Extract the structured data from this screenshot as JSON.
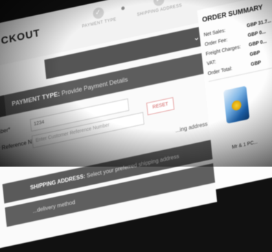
{
  "header": {
    "title": "CKOUT",
    "steps": [
      {
        "label": "PAYMENT TYPE"
      },
      {
        "label": "SHIPPING ADDRESS"
      }
    ]
  },
  "sections": {
    "payment": {
      "title": "PAYMENT TYPE:",
      "subtitle": "Provide Payment Details"
    },
    "shipping": {
      "title": "SHIPPING ADDRESS:",
      "subtitle": "Select your preferred shipping address"
    },
    "delivery": {
      "subtitle": "...delivery method"
    }
  },
  "form": {
    "po_label": "...mber*",
    "po_value": "1234",
    "ref_label": "...mer Reference Number",
    "ref_placeholder": "Enter Customer Reference Number",
    "reset_label": "RESET",
    "address_note": "...ing address"
  },
  "summary": {
    "title": "ORDER SUMMARY",
    "rows": [
      {
        "label": "Net Sales:",
        "value": "GBP 31.7..."
      },
      {
        "label": "Order Fee:",
        "value": "GBP 0..."
      },
      {
        "label": "Freight Charges:",
        "value": "GBP 0..."
      },
      {
        "label": "VAT:",
        "value": "GBP"
      },
      {
        "label": "Order Total:",
        "value": "GBP"
      }
    ],
    "bottom_text": "Mr & 1 PC..."
  }
}
